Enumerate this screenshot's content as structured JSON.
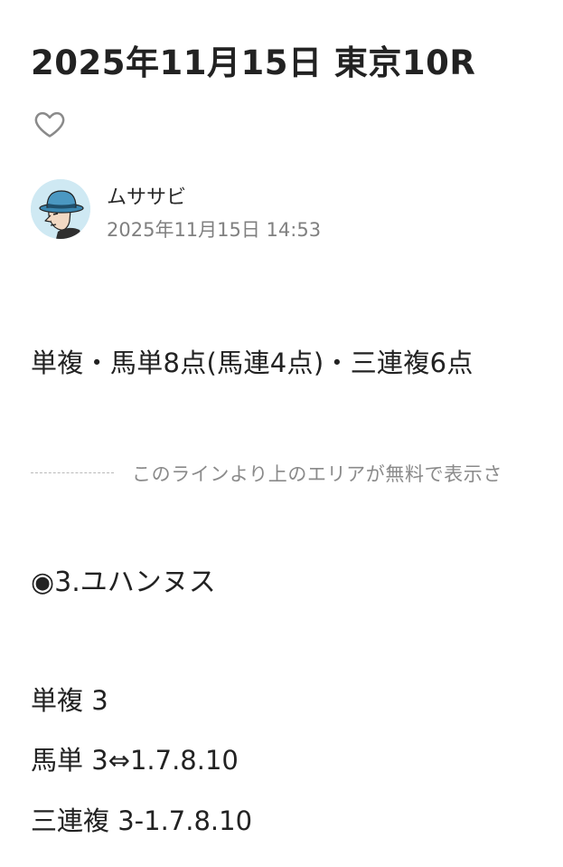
{
  "article": {
    "title": "2025年11月15日 東京10R",
    "like_icon": "heart-outline-icon"
  },
  "author": {
    "name": "ムササビ",
    "date": "2025年11月15日 14:53",
    "avatar_icon": "man-in-fedora-avatar"
  },
  "content": {
    "summary": "単複・馬単8点(馬連4点)・三連複6点",
    "paywall_notice": "このラインより上のエリアが無料で表示さ",
    "pick": "◉3.ユハンヌス",
    "bets": [
      "単複 3",
      "馬単 3⇔1.7.8.10",
      "三連複 3-1.7.8.10"
    ]
  },
  "colors": {
    "text": "#222222",
    "muted": "#808080",
    "avatar_bg": "#cfe9f3",
    "hat": "#3a86b0"
  }
}
